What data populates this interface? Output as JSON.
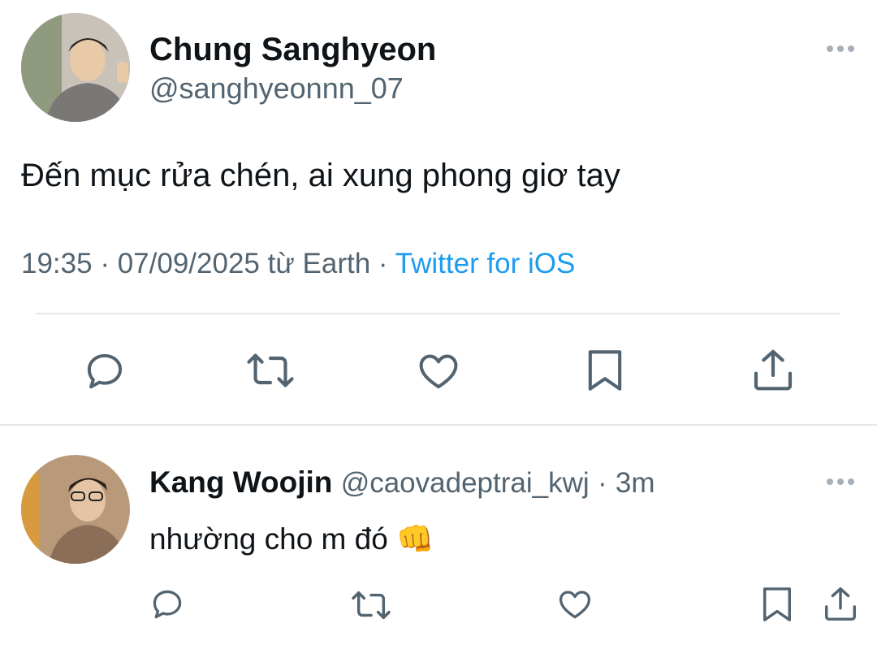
{
  "main_tweet": {
    "author_name": "Chung Sanghyeon",
    "author_handle": "@sanghyeonnn_07",
    "text": "Đến mục rửa chén, ai xung phong giơ tay",
    "time": "19:35",
    "sep1": "·",
    "date": "07/09/2025",
    "location": "từ Earth",
    "sep2": "·",
    "source": "Twitter for iOS"
  },
  "reply": {
    "author_name": "Kang Woojin",
    "author_handle": "@caovadeptrai_kwj",
    "sep": "·",
    "age": "3m",
    "text": "nhường cho m đó",
    "emoji": "👊"
  },
  "icons": {
    "reply": "comment-icon",
    "retweet": "retweet-icon",
    "like": "heart-icon",
    "bookmark": "bookmark-icon",
    "share": "share-icon",
    "more": "more-options-icon"
  },
  "colors": {
    "text": "#0f1419",
    "secondary": "#536471",
    "link": "#1d9bf0",
    "divider": "#e3e7ea",
    "icon": "#536471"
  }
}
